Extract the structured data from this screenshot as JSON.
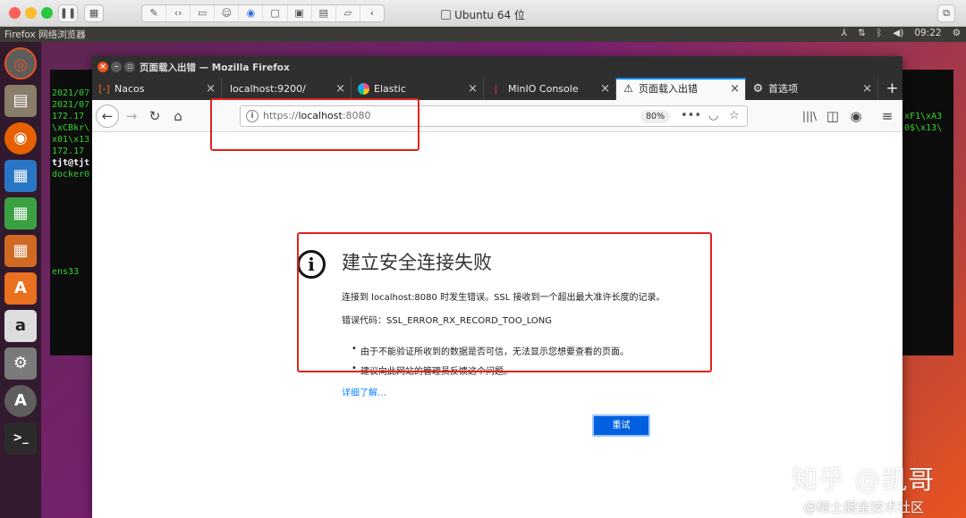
{
  "vm": {
    "title": "Ubuntu 64 位",
    "toolbar_icons": [
      "pause-icon",
      "settings-icon",
      "wrench-icon",
      "code-icon",
      "drive-icon",
      "user-icon",
      "audio-icon",
      "camera-icon",
      "video-icon",
      "printer-icon",
      "folder-icon",
      "chevron-left-icon"
    ]
  },
  "ubuntu_panel": {
    "app_name": "Firefox 网络浏览器",
    "clock": "09:22"
  },
  "terminal": {
    "lines": [
      "2021/07",
      "2021/07",
      "172.17",
      "\\xCBkr\\",
      "x01\\x13",
      "172.17",
      "tjt@tjt",
      "docker0",
      "ens33"
    ],
    "right_lines": [
      "xF1\\xA3",
      "0$\\x13\\"
    ]
  },
  "firefox": {
    "window_title": "页面载入出错 — Mozilla Firefox",
    "tabs": [
      {
        "label": "Nacos",
        "icon": "nacos-icon"
      },
      {
        "label": "localhost:9200/",
        "icon": ""
      },
      {
        "label": "Elastic",
        "icon": "elastic-icon"
      },
      {
        "label": "MinIO Console",
        "icon": "minio-icon"
      },
      {
        "label": "页面载入出错",
        "icon": "warning-icon",
        "active": true
      },
      {
        "label": "首选项",
        "icon": "gear-icon"
      }
    ],
    "url": {
      "scheme": "https://",
      "host": "localhost",
      "port": ":8080"
    },
    "zoom": "80%"
  },
  "error": {
    "title": "建立安全连接失败",
    "description": "连接到 localhost:8080 时发生错误。SSL 接收到一个超出最大准许长度的记录。",
    "code_line": "错误代码：SSL_ERROR_RX_RECORD_TOO_LONG",
    "bullets": [
      "由于不能验证所收到的数据是否可信，无法显示您想要查看的页面。",
      "建议向此网站的管理员反馈这个问题。"
    ],
    "learn_more": "详细了解…",
    "try_again": "重试"
  },
  "watermark": {
    "main": "知乎 @凯哥",
    "sub": "@稀土掘金技术社区"
  },
  "colors": {
    "accent": "#0060df",
    "annotation": "#e2231a",
    "ubuntu_orange": "#e95420"
  }
}
